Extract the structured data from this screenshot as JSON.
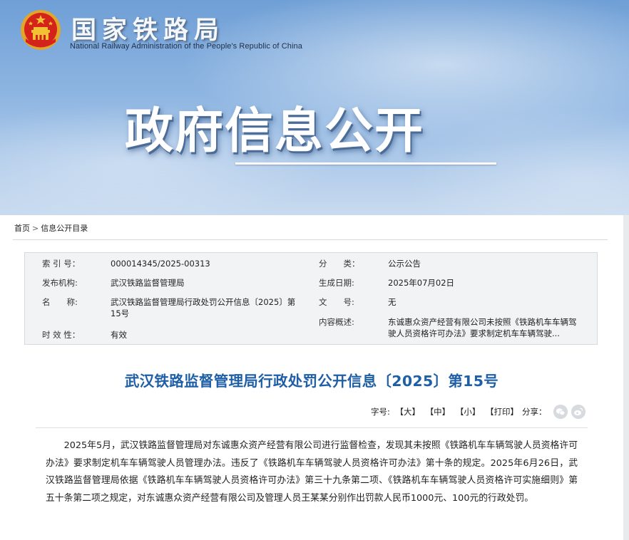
{
  "header": {
    "org_cn": "国家铁路局",
    "org_en": "National Railway Administration of the People's Republic of China",
    "hero_title": "政府信息公开"
  },
  "breadcrumb": {
    "home": "首页",
    "separator": ">",
    "current": "信息公开目录"
  },
  "meta": {
    "index_label": "索 引 号：",
    "index_value": "000014345/2025-00313",
    "category_label": "分　　类：",
    "category_value": "公示公告",
    "publisher_label": "发布机构:",
    "publisher_value": "武汉铁路监督管理局",
    "date_label": "生成日期:",
    "date_value": "2025年07月02日",
    "name_label": "名　　称:",
    "name_value": "武汉铁路监督管理局行政处罚公开信息〔2025〕第15号",
    "docno_label": "文　　号:",
    "docno_value": "无",
    "summary_label": "内容概述:",
    "summary_value": "东诚惠众资产经营有限公司未按照《铁路机车车辆驾驶人员资格许可办法》要求制定机车车辆驾驶...",
    "validity_label": "时 效 性：",
    "validity_value": "有效"
  },
  "article": {
    "title": "武汉铁路监督管理局行政处罚公开信息〔2025〕第15号",
    "font_label": "字号:",
    "font_large": "【大】",
    "font_medium": "【中】",
    "font_small": "【小】",
    "print": "【打印】",
    "share_label": "分享：",
    "body": "2025年5月，武汉铁路监督管理局对东诚惠众资产经营有限公司进行监督检查，发现其未按照《铁路机车车辆驾驶人员资格许可办法》要求制定机车车辆驾驶人员管理办法。违反了《铁路机车车辆驾驶人员资格许可办法》第十条的规定。2025年6月26日，武汉铁路监督管理局依据《铁路机车车辆驾驶人员资格许可办法》第三十九条第二项、《铁路机车车辆驾驶人员资格许可实施细则》第五十条第二项之规定，对东诚惠众资产经营有限公司及管理人员王某某分别作出罚款人民币1000元、100元的行政处罚。"
  },
  "icons": {
    "emblem": "national-emblem-icon",
    "wechat": "wechat-icon",
    "weibo": "weibo-icon"
  },
  "colors": {
    "title_blue": "#1f5fa6",
    "emblem_red": "#d4231b",
    "emblem_gold": "#f3c234"
  }
}
